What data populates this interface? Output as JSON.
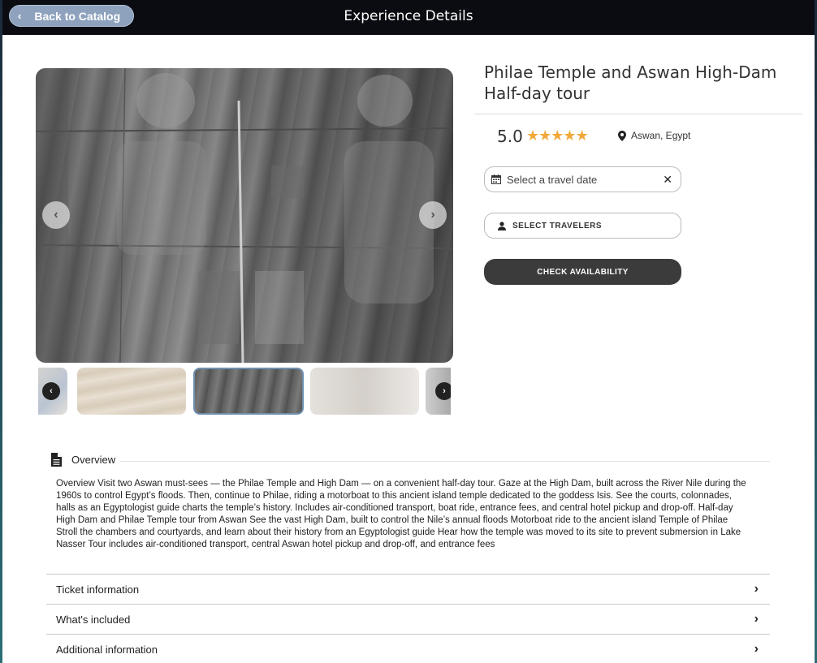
{
  "header": {
    "back_label": "Back to Catalog",
    "title": "Experience Details"
  },
  "experience": {
    "title": "Philae Temple and Aswan High-Dam Half-day tour",
    "rating": "5.0",
    "rating_stars": 5,
    "location": "Aswan, Egypt"
  },
  "booking": {
    "date_placeholder": "Select a travel date",
    "travelers_label": "SELECT TRAVELERS",
    "check_label": "CHECK AVAILABILITY"
  },
  "overview": {
    "heading": "Overview",
    "text": "Overview Visit two Aswan must-sees — the Philae Temple and High Dam — on a convenient half-day tour. Gaze at the High Dam, built across the River Nile during the 1960s to control Egypt’s floods. Then, continue to Philae, riding a motorboat to this ancient island temple dedicated to the goddess Isis. See the courts, colonnades, halls as an Egyptologist guide charts the temple’s history. Includes air-conditioned transport, boat ride, entrance fees, and central hotel pickup and drop-off. Half-day High Dam and Philae Temple tour from Aswan See the vast High Dam, built to control the Nile’s annual floods Motorboat ride to the ancient island Temple of Philae Stroll the chambers and courtyards, and learn about their history from an Egyptologist guide Hear how the temple was moved to its site to prevent submersion in Lake Nasser Tour includes air-conditioned transport, central Aswan hotel pickup and drop-off, and entrance fees"
  },
  "sections": [
    {
      "label": "Ticket information"
    },
    {
      "label": "What's included"
    },
    {
      "label": "Additional information"
    }
  ],
  "icons": {
    "back": "chevron-left-icon",
    "calendar": "calendar-icon",
    "clear": "close-icon",
    "user": "user-icon",
    "location": "map-pin-icon",
    "document": "document-icon",
    "expand": "chevron-right-icon"
  },
  "colors": {
    "topbar": "#0a0c12",
    "back_button": "#8ea2bd",
    "star": "#f2a93b",
    "primary_button": "#3b3b3b"
  }
}
